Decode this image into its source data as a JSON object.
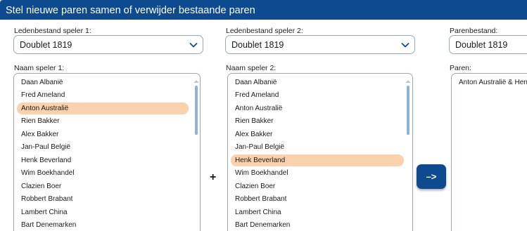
{
  "title": "Stel nieuwe paren samen of verwijder bestaande paren",
  "player1": {
    "file_label": "Ledenbestand speler 1:",
    "file_value": "Doublet 1819",
    "name_label": "Naam speler 1:",
    "items": [
      "Daan Albanië",
      "Fred Ameland",
      "Anton Australië",
      "Rien Bakker",
      "Alex Bakker",
      "Jan-Paul België",
      "Henk Beverland",
      "Wim Boekhandel",
      "Clazien Boer",
      "Robbert Brabant",
      "Lambert China",
      "Bart Denemarken"
    ],
    "selected_index": 2
  },
  "player2": {
    "file_label": "Ledenbestand speler 2:",
    "file_value": "Doublet 1819",
    "name_label": "Naam speler 2:",
    "items": [
      "Daan Albanië",
      "Fred Ameland",
      "Anton Australië",
      "Rien Bakker",
      "Alex Bakker",
      "Jan-Paul België",
      "Henk Beverland",
      "Wim Boekhandel",
      "Clazien Boer",
      "Robbert Brabant",
      "Lambert China",
      "Bart Denemarken"
    ],
    "selected_index": 6
  },
  "plus_sign": "+",
  "move_button_label": "–>",
  "pairs": {
    "file_label": "Parenbestand:",
    "file_value": "Doublet 1819",
    "list_label": "Paren:",
    "items": [
      "Anton Australië & Henk Beverland"
    ]
  },
  "colors": {
    "titlebar": "#0d4a8f",
    "selected_row": "#fbd2ad",
    "scroll_thumb": "#8fb3d6",
    "border": "#9aa8b8"
  },
  "icons": {
    "dropdown": "chevron-down-icon",
    "scroll_up": "scroll-up-arrow-icon"
  }
}
